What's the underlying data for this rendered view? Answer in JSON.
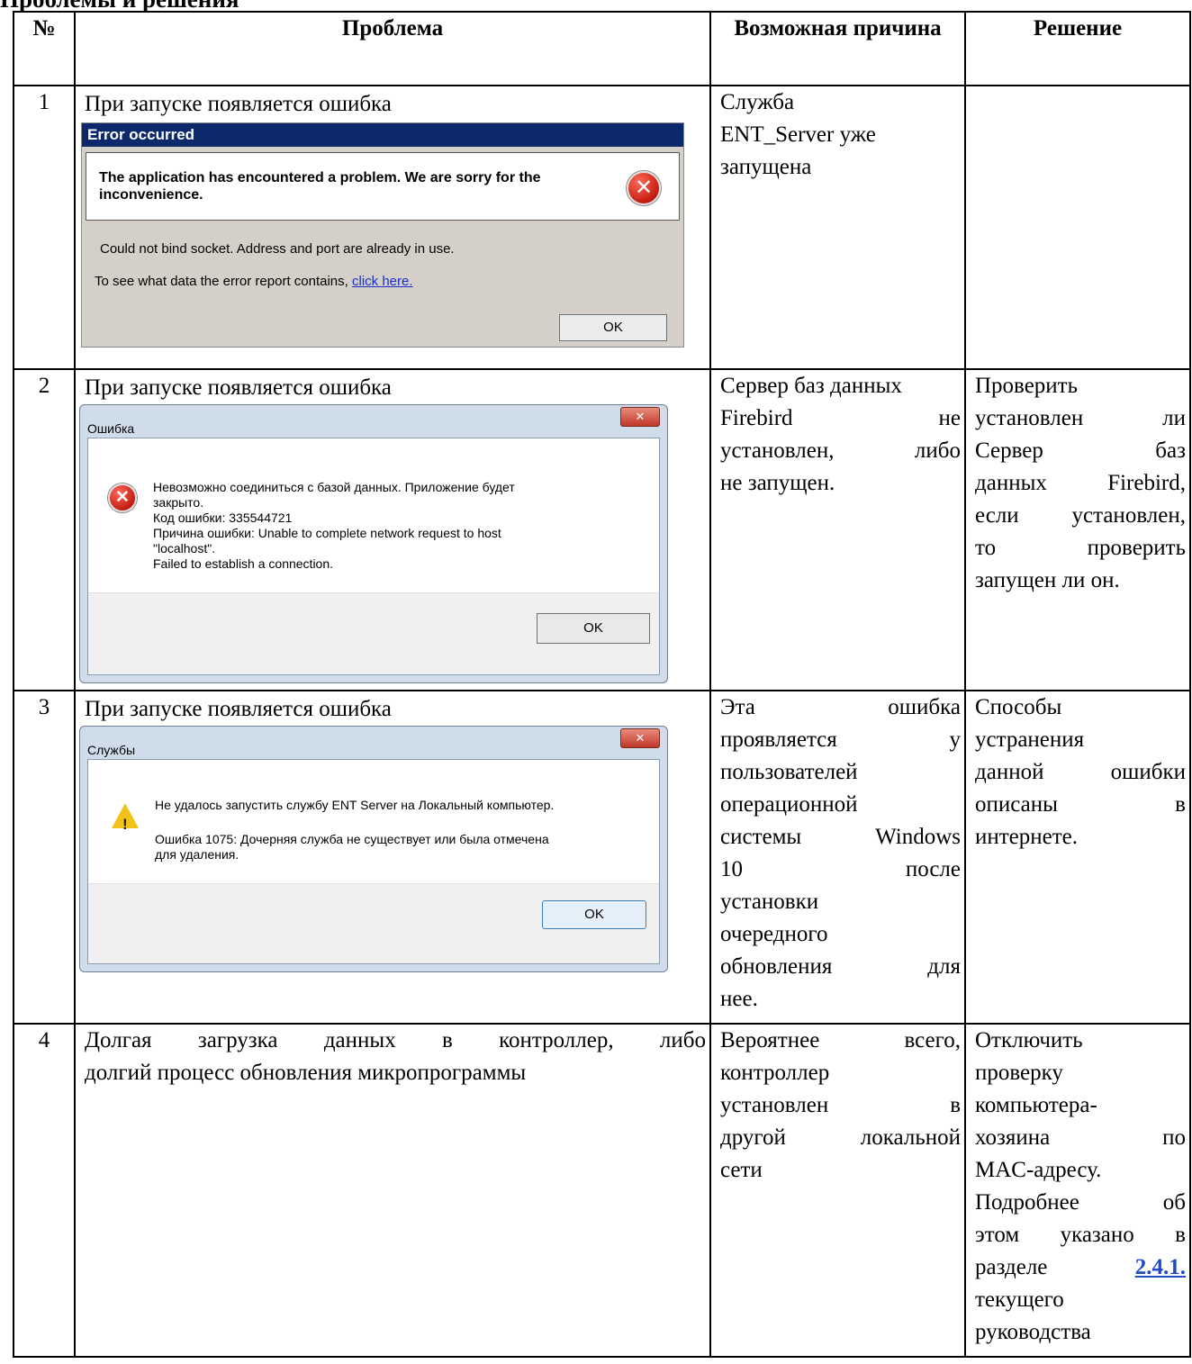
{
  "top_fragment": "",
  "headers": {
    "num": "№",
    "problem": "Проблема",
    "cause": "Возможная причина",
    "solution": "Решение"
  },
  "rows": [
    {
      "num": "1",
      "problem": "При запуске появляется ошибка",
      "cause_lines": [
        "Служба",
        "ENT_Server уже",
        "запущена"
      ],
      "solution": "",
      "dialog": {
        "title": "Error occurred",
        "headline": "The application has encountered a problem. We are sorry for the inconvenience.",
        "detail": "Could not bind socket. Address and port are already in use.",
        "report_prefix": "To see what data the error report contains,",
        "report_link": "click here.",
        "ok": "OK"
      }
    },
    {
      "num": "2",
      "problem": "При запуске появляется ошибка",
      "cause_lines": [
        "Сервер баз данных",
        "Firebird не",
        "установлен, либо",
        "не запущен."
      ],
      "solution_lines": [
        "Проверить",
        "установлен ли",
        "Сервер баз",
        "данных Firebird,",
        "если установлен,",
        "то проверить",
        "запущен ли он."
      ],
      "dialog": {
        "title": "Ошибка",
        "lines": [
          "Невозможно соединиться с базой данных. Приложение будет",
          "закрыто.",
          "Код ошибки: 335544721",
          "Причина ошибки: Unable to complete network request to host",
          "\"localhost\".",
          "Failed to establish a connection."
        ],
        "ok": "OK"
      }
    },
    {
      "num": "3",
      "problem": "При запуске появляется ошибка",
      "cause_lines": [
        "Эта ошибка",
        "проявляется у",
        "пользователей",
        "операционной",
        "системы Windows",
        "10 после",
        "установки",
        "очередного",
        "обновления для",
        "нее."
      ],
      "solution_lines": [
        "Способы",
        "устранения",
        "данной ошибки",
        "описаны в",
        "интернете."
      ],
      "dialog": {
        "title": "Службы",
        "line1": "Не удалось запустить службу ENT Server на Локальный компьютер.",
        "line2": "Ошибка 1075: Дочерняя служба не существует или была отмечена",
        "line3": "для удаления.",
        "ok": "OK"
      }
    },
    {
      "num": "4",
      "problem_lines": [
        "Долгая загрузка данных в контроллер, либо",
        "долгий процесс обновления микропрограммы"
      ],
      "cause_lines": [
        "Вероятнее всего,",
        "контроллер",
        "установлен в",
        "другой локальной",
        "сети"
      ],
      "solution_lines": [
        "Отключить",
        "проверку",
        "компьютера-",
        "хозяина по",
        "MAC-адресу.",
        "Подробнее об",
        "этом указано в"
      ],
      "solution_link_prefix": "разделе",
      "solution_link": "2.4.1.",
      "solution_tail": [
        "текущего",
        "руководства"
      ]
    }
  ]
}
